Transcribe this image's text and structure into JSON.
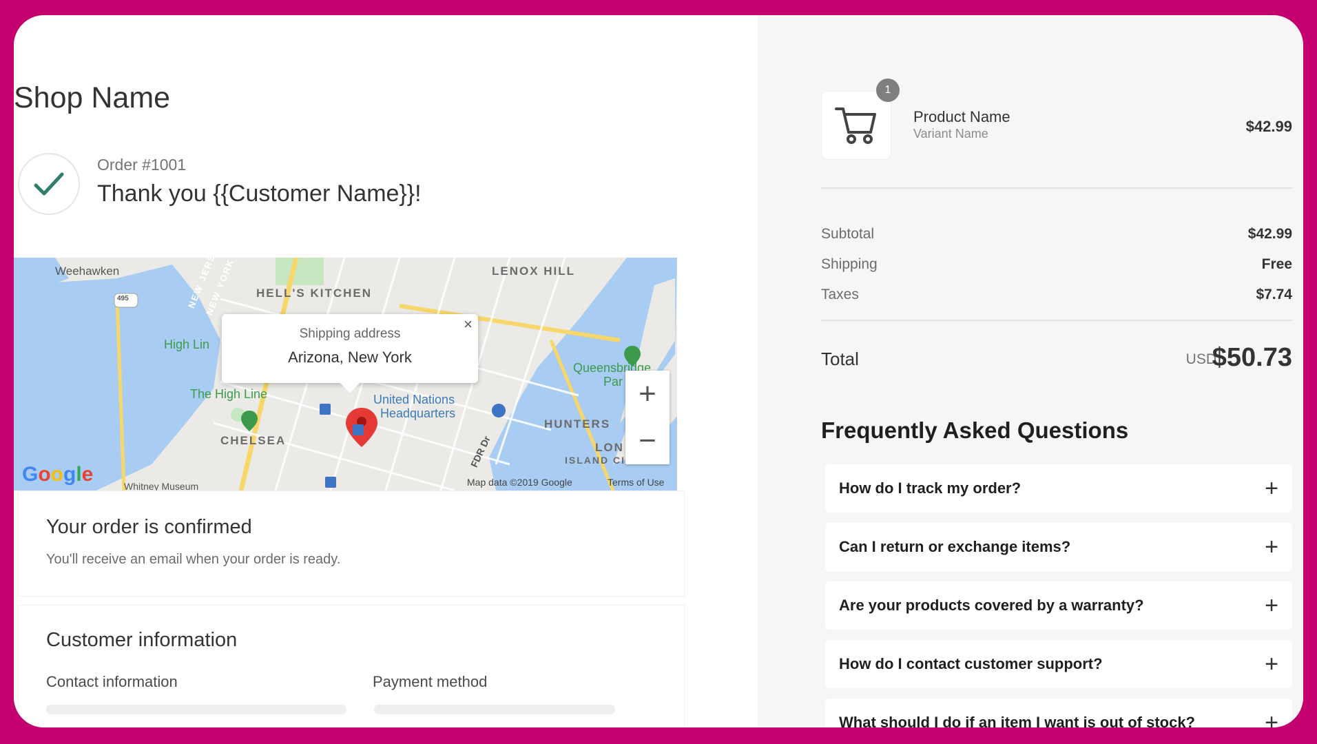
{
  "shop": {
    "name": "Shop Name"
  },
  "order": {
    "number": "Order #1001",
    "thank_you": "Thank you {{Customer Name}}!"
  },
  "map": {
    "popup_title": "Shipping address",
    "popup_address": "Arizona, New York",
    "close_glyph": "×",
    "zoom_in": "+",
    "zoom_out": "−",
    "labels": {
      "weehawken": "Weehawken",
      "hells_kitchen": "HELL'S KITCHEN",
      "lenox_hill": "LENOX HILL",
      "high_line_park": "High Lin",
      "the_high_line": "The High Line",
      "un_hq_1": "United Nations",
      "un_hq_2": "Headquarters",
      "queensbridge": "Queensbridge",
      "queensbridge_2": "Par",
      "chelsea": "CHELSEA",
      "hunters": "HUNTERS",
      "new_jersey": "NEW JERSEY",
      "new_york": "NEW YORK",
      "lon": "LON",
      "island_city": "ISLAND CITY",
      "whitney": "Whitney Museum",
      "fdr": "FDR Dr",
      "route": "495"
    },
    "google": "Google",
    "credit_data": "Map data ©2019 Google",
    "credit_terms": "Terms of Use",
    "colors": {
      "water": "#a9cdf2",
      "park": "#c6e7c0",
      "land": "#ebeae6",
      "road_major": "#f7d769",
      "pin": "#e53935"
    }
  },
  "confirmation": {
    "title": "Your order is confirmed",
    "text": "You'll receive an email when your order is ready."
  },
  "customer": {
    "title": "Customer information",
    "contact_label": "Contact information",
    "payment_label": "Payment method"
  },
  "summary": {
    "badge": "1",
    "product_name": "Product Name",
    "variant_name": "Variant Name",
    "product_price": "$42.99",
    "subtotal_label": "Subtotal",
    "subtotal_value": "$42.99",
    "shipping_label": "Shipping",
    "shipping_value": "Free",
    "taxes_label": "Taxes",
    "taxes_value": "$7.74",
    "total_label": "Total",
    "currency": "USD",
    "total_value": "$50.73"
  },
  "faq": {
    "heading": "Frequently Asked Questions",
    "items": [
      {
        "question": "How do I track my order?",
        "icon": "+"
      },
      {
        "question": "Can I return or exchange items?",
        "icon": "+"
      },
      {
        "question": "Are your products covered by a warranty?",
        "icon": "+"
      },
      {
        "question": "How do I contact customer support?",
        "icon": "+"
      },
      {
        "question": "What should I do if an item I want is out of stock?",
        "icon": "+"
      }
    ]
  },
  "accent": {
    "check": "#2f7d6a",
    "frame": "#c4006e"
  }
}
